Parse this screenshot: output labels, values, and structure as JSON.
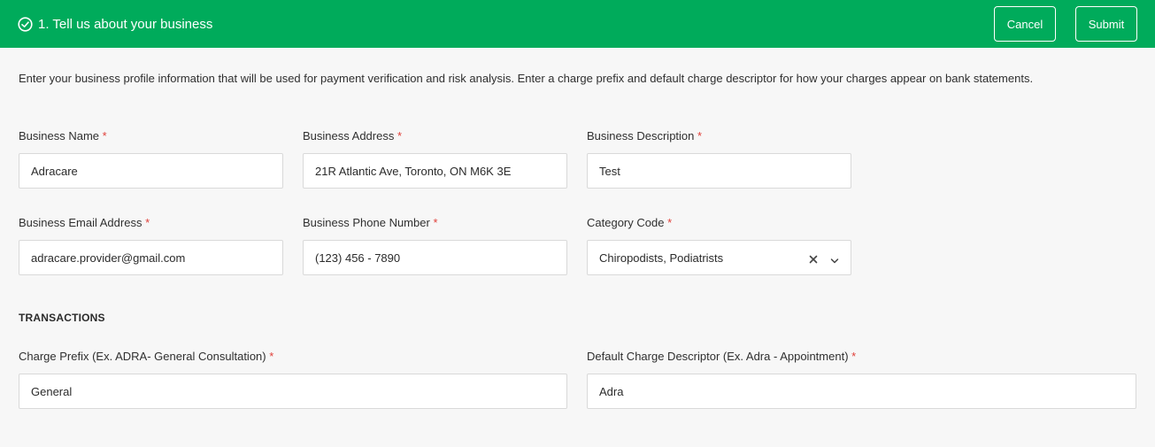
{
  "header": {
    "title": "1. Tell us about your business",
    "cancel_label": "Cancel",
    "submit_label": "Submit",
    "bg_color": "#00ab5b"
  },
  "intro_text": "Enter your business profile information that will be used for payment verification and risk analysis. Enter a charge prefix and default charge descriptor for how your charges appear on bank statements.",
  "required_marker": "*",
  "fields": {
    "business_name": {
      "label": "Business Name",
      "value": "Adracare"
    },
    "business_address": {
      "label": "Business Address",
      "value": "21R Atlantic Ave, Toronto, ON M6K 3E"
    },
    "business_description": {
      "label": "Business Description",
      "value": "Test"
    },
    "business_email": {
      "label": "Business Email Address",
      "value": "adracare.provider@gmail.com"
    },
    "business_phone": {
      "label": "Business Phone Number",
      "value": "(123) 456 - 7890"
    },
    "category_code": {
      "label": "Category Code",
      "value": "Chiropodists, Podiatrists"
    }
  },
  "transactions": {
    "title": "TRANSACTIONS",
    "charge_prefix": {
      "label": "Charge Prefix (Ex. ADRA- General Consultation)",
      "value": "General"
    },
    "charge_descriptor": {
      "label": "Default Charge Descriptor (Ex. Adra - Appointment)",
      "value": "Adra"
    }
  },
  "icons": {
    "header": "check-circle-icon",
    "clear": "clear-icon",
    "dropdown": "chevron-down-icon"
  }
}
